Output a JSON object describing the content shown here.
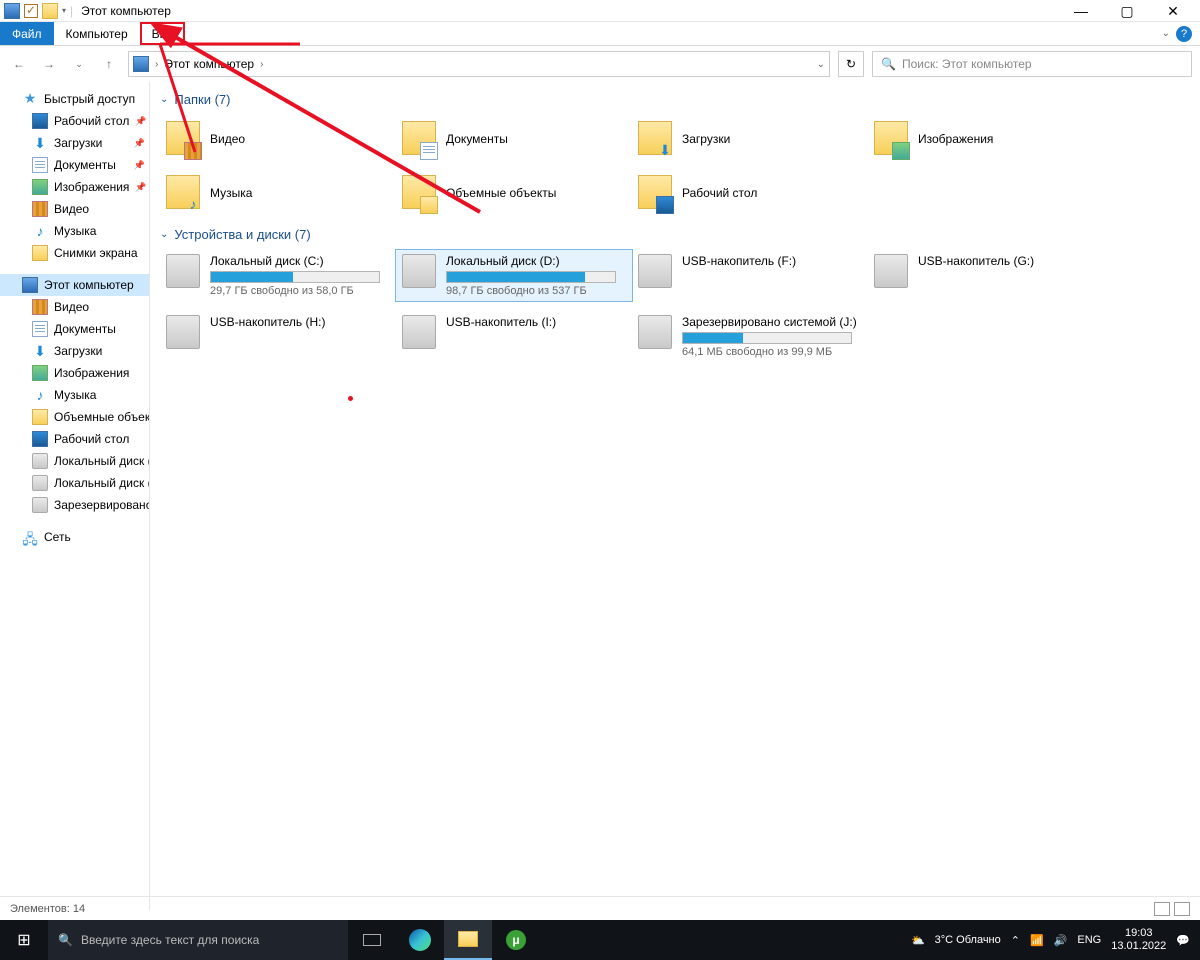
{
  "window": {
    "title": "Этот компьютер"
  },
  "tabs": {
    "file": "Файл",
    "computer": "Компьютер",
    "view": "Вид"
  },
  "address": {
    "location": "Этот компьютер",
    "search_placeholder": "Поиск: Этот компьютер"
  },
  "sidebar": {
    "quick_access": "Быстрый доступ",
    "desktop": "Рабочий стол",
    "downloads": "Загрузки",
    "documents": "Документы",
    "pictures": "Изображения",
    "videos": "Видео",
    "music": "Музыка",
    "screenshots": "Снимки экрана",
    "this_pc": "Этот компьютер",
    "pc_videos": "Видео",
    "pc_documents": "Документы",
    "pc_downloads": "Загрузки",
    "pc_pictures": "Изображения",
    "pc_music": "Музыка",
    "pc_objects": "Объемные объекты",
    "pc_desktop": "Рабочий стол",
    "pc_drive_c": "Локальный диск (C:)",
    "pc_drive_d": "Локальный диск (D:)",
    "pc_reserved": "Зарезервировано с",
    "network": "Сеть"
  },
  "groups": {
    "folders": "Папки (7)",
    "drives": "Устройства и диски (7)"
  },
  "folders": [
    {
      "name": "Видео"
    },
    {
      "name": "Документы"
    },
    {
      "name": "Загрузки"
    },
    {
      "name": "Изображения"
    },
    {
      "name": "Музыка"
    },
    {
      "name": "Объемные объекты"
    },
    {
      "name": "Рабочий стол"
    }
  ],
  "drives": [
    {
      "name": "Локальный диск (C:)",
      "free": "29,7 ГБ свободно из 58,0 ГБ",
      "fill": 49
    },
    {
      "name": "Локальный диск (D:)",
      "free": "98,7 ГБ свободно из 537 ГБ",
      "fill": 82
    },
    {
      "name": "USB-накопитель (F:)",
      "free": "",
      "fill": -1
    },
    {
      "name": "USB-накопитель (G:)",
      "free": "",
      "fill": -1
    },
    {
      "name": "USB-накопитель (H:)",
      "free": "",
      "fill": -1
    },
    {
      "name": "USB-накопитель (I:)",
      "free": "",
      "fill": -1
    },
    {
      "name": "Зарезервировано системой (J:)",
      "free": "64,1 МБ свободно из 99,9 МБ",
      "fill": 36
    }
  ],
  "status": {
    "elements": "Элементов: 14"
  },
  "taskbar": {
    "search_placeholder": "Введите здесь текст для поиска",
    "weather": "3°C Облачно",
    "lang": "ENG",
    "time": "19:03",
    "date": "13.01.2022"
  }
}
